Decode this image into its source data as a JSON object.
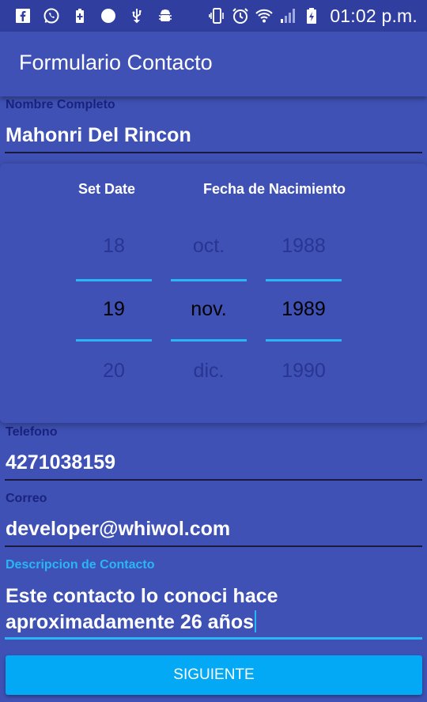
{
  "status_bar": {
    "icons": [
      "facebook-icon",
      "whatsapp-icon",
      "battery-saver-icon",
      "circle-icon",
      "usb-icon",
      "android-debug-icon",
      "vibrate-icon",
      "alarm-icon",
      "wifi-icon",
      "signal-icon",
      "battery-charging-icon"
    ],
    "time": "01:02 p.m."
  },
  "app_bar": {
    "title": "Formulario Contacto"
  },
  "form": {
    "name": {
      "label": "Nombre Completo",
      "value": "Mahonri Del Rincon"
    },
    "date_picker": {
      "set_label": "Set Date",
      "title": "Fecha de Nacimiento",
      "day": {
        "prev": "18",
        "current": "19",
        "next": "20"
      },
      "month": {
        "prev": "oct.",
        "current": "nov.",
        "next": "dic."
      },
      "year": {
        "prev": "1988",
        "current": "1989",
        "next": "1990"
      }
    },
    "phone": {
      "label": "Telefono",
      "value": "4271038159"
    },
    "email": {
      "label": "Correo",
      "value": "developer@whiwol.com"
    },
    "description": {
      "label": "Descripcion de Contacto",
      "line1": "Este contacto lo conoci hace",
      "line2": "aproximadamente 26 años"
    }
  },
  "next_button": {
    "label": "SIGUIENTE"
  },
  "colors": {
    "primary": "#3f51b5",
    "primary_dark": "#303f9f",
    "accent": "#03a9f4",
    "label_dark": "#1a237e"
  }
}
